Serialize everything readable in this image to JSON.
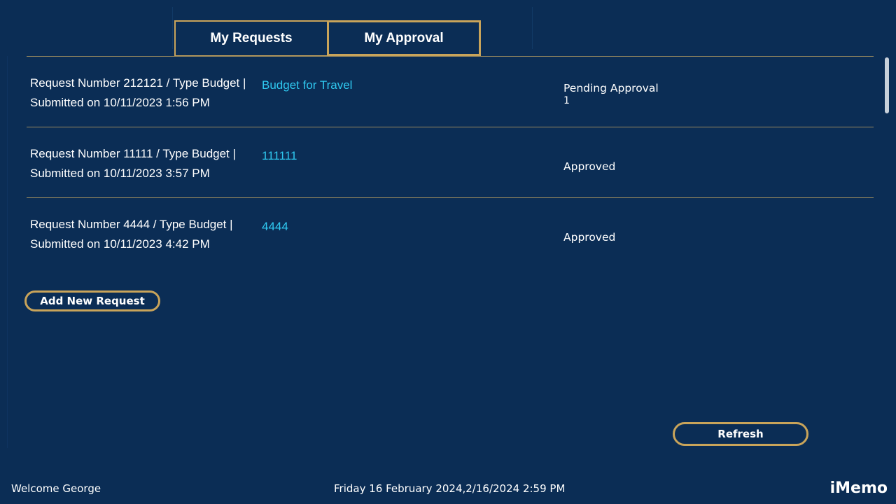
{
  "tabs": {
    "my_requests": "My Requests",
    "my_approval": "My Approval"
  },
  "requests": [
    {
      "line1": "Request Number 212121 / Type Budget |",
      "line2": "Submitted on 10/11/2023 1:56 PM",
      "title": "Budget for Travel",
      "status": "Pending Approval",
      "status_count": "1"
    },
    {
      "line1": "Request Number 11111 / Type Budget |",
      "line2": "Submitted on 10/11/2023 3:57 PM",
      "title": "111111",
      "status": "Approved"
    },
    {
      "line1": "Request Number 4444 / Type Budget |",
      "line2": "Submitted on 10/11/2023 4:42 PM",
      "title": "4444",
      "status": "Approved"
    }
  ],
  "buttons": {
    "add_new_request": "Add New Request",
    "refresh": "Refresh"
  },
  "footer": {
    "welcome": "Welcome George",
    "datetime": "Friday 16 February 2024,2/16/2024 2:59 PM",
    "brand": "iMemo"
  },
  "colors": {
    "background": "#0b2d55",
    "accent_gold": "#c9a45a",
    "link_cyan": "#2fc8f0"
  }
}
